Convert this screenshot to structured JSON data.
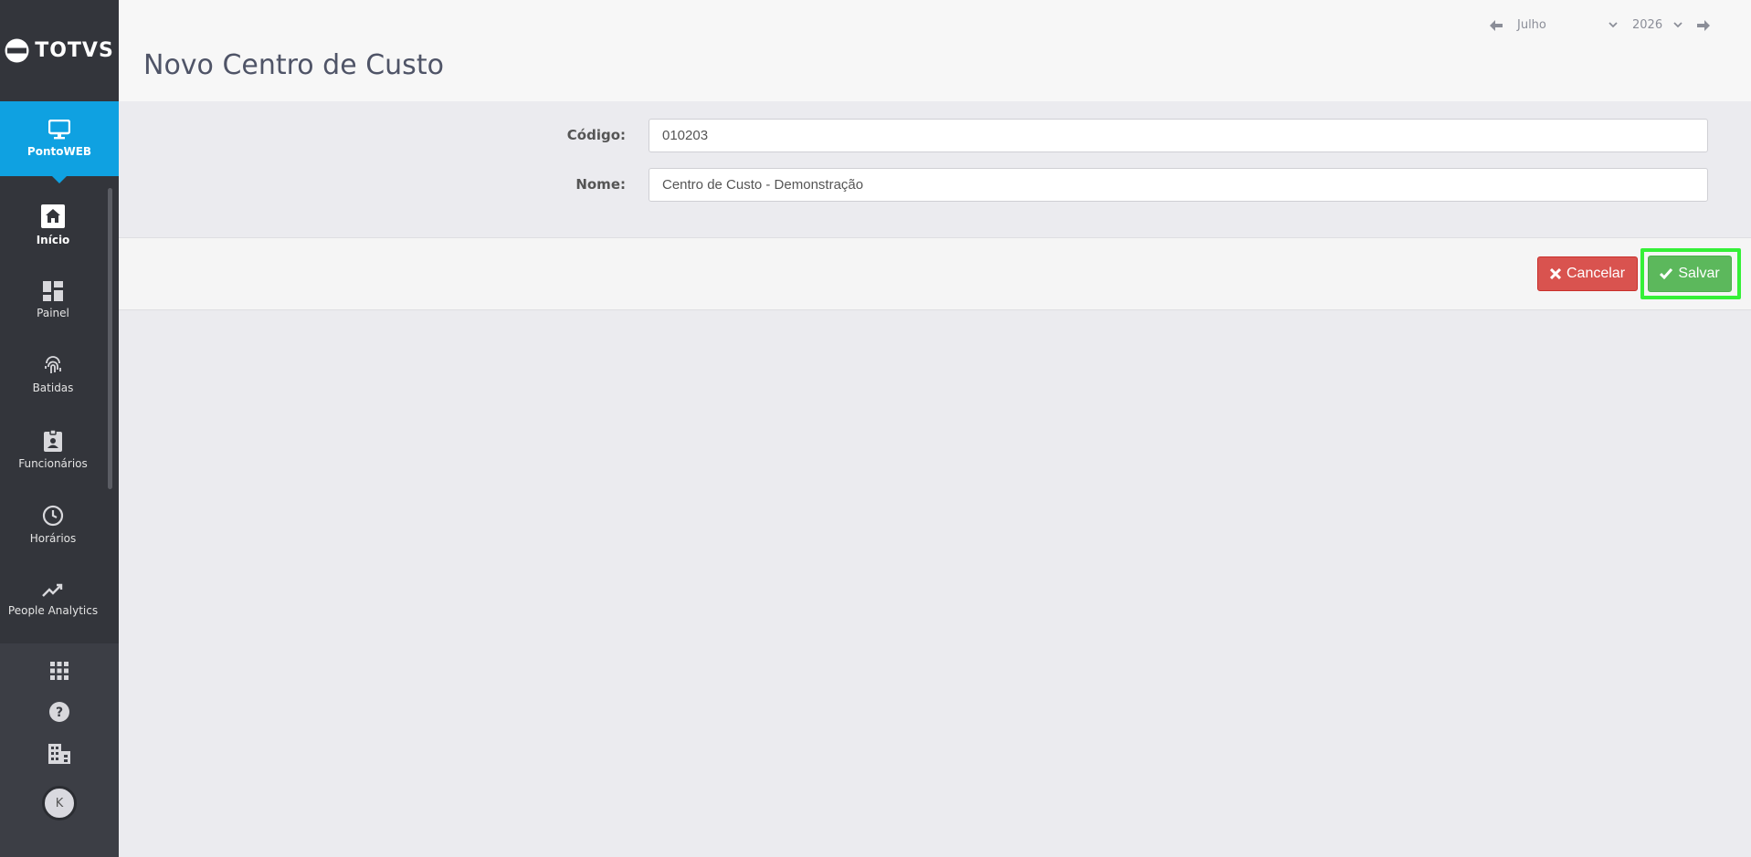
{
  "brand": {
    "logo_text": "TOTVS"
  },
  "app": {
    "name": "PontoWEB"
  },
  "sidebar": {
    "items": [
      {
        "label": "Início",
        "icon": "home-icon",
        "active": true
      },
      {
        "label": "Painel",
        "icon": "dashboard-icon",
        "active": false
      },
      {
        "label": "Batidas",
        "icon": "fingerprint-icon",
        "active": false
      },
      {
        "label": "Funcionários",
        "icon": "badge-icon",
        "active": false
      },
      {
        "label": "Horários",
        "icon": "clock-icon",
        "active": false
      },
      {
        "label": "People Analytics",
        "icon": "trend-icon",
        "active": false
      }
    ],
    "bottom": {
      "apps_icon": "grid-icon",
      "help_icon": "help-icon",
      "company_icon": "building-icon",
      "avatar_initial": "K"
    }
  },
  "header": {
    "title": "Novo Centro de Custo",
    "period": {
      "month": "Julho",
      "year": "2026"
    }
  },
  "form": {
    "codigo": {
      "label": "Código:",
      "value": "010203"
    },
    "nome": {
      "label": "Nome:",
      "value": "Centro de Custo - Demonstração"
    }
  },
  "actions": {
    "cancel_label": "Cancelar",
    "save_label": "Salvar"
  },
  "colors": {
    "sidebar_bg": "#33353b",
    "app_tile": "#0fa1e1",
    "cancel": "#d9534f",
    "save": "#5cb85c",
    "highlight": "#35f038"
  }
}
